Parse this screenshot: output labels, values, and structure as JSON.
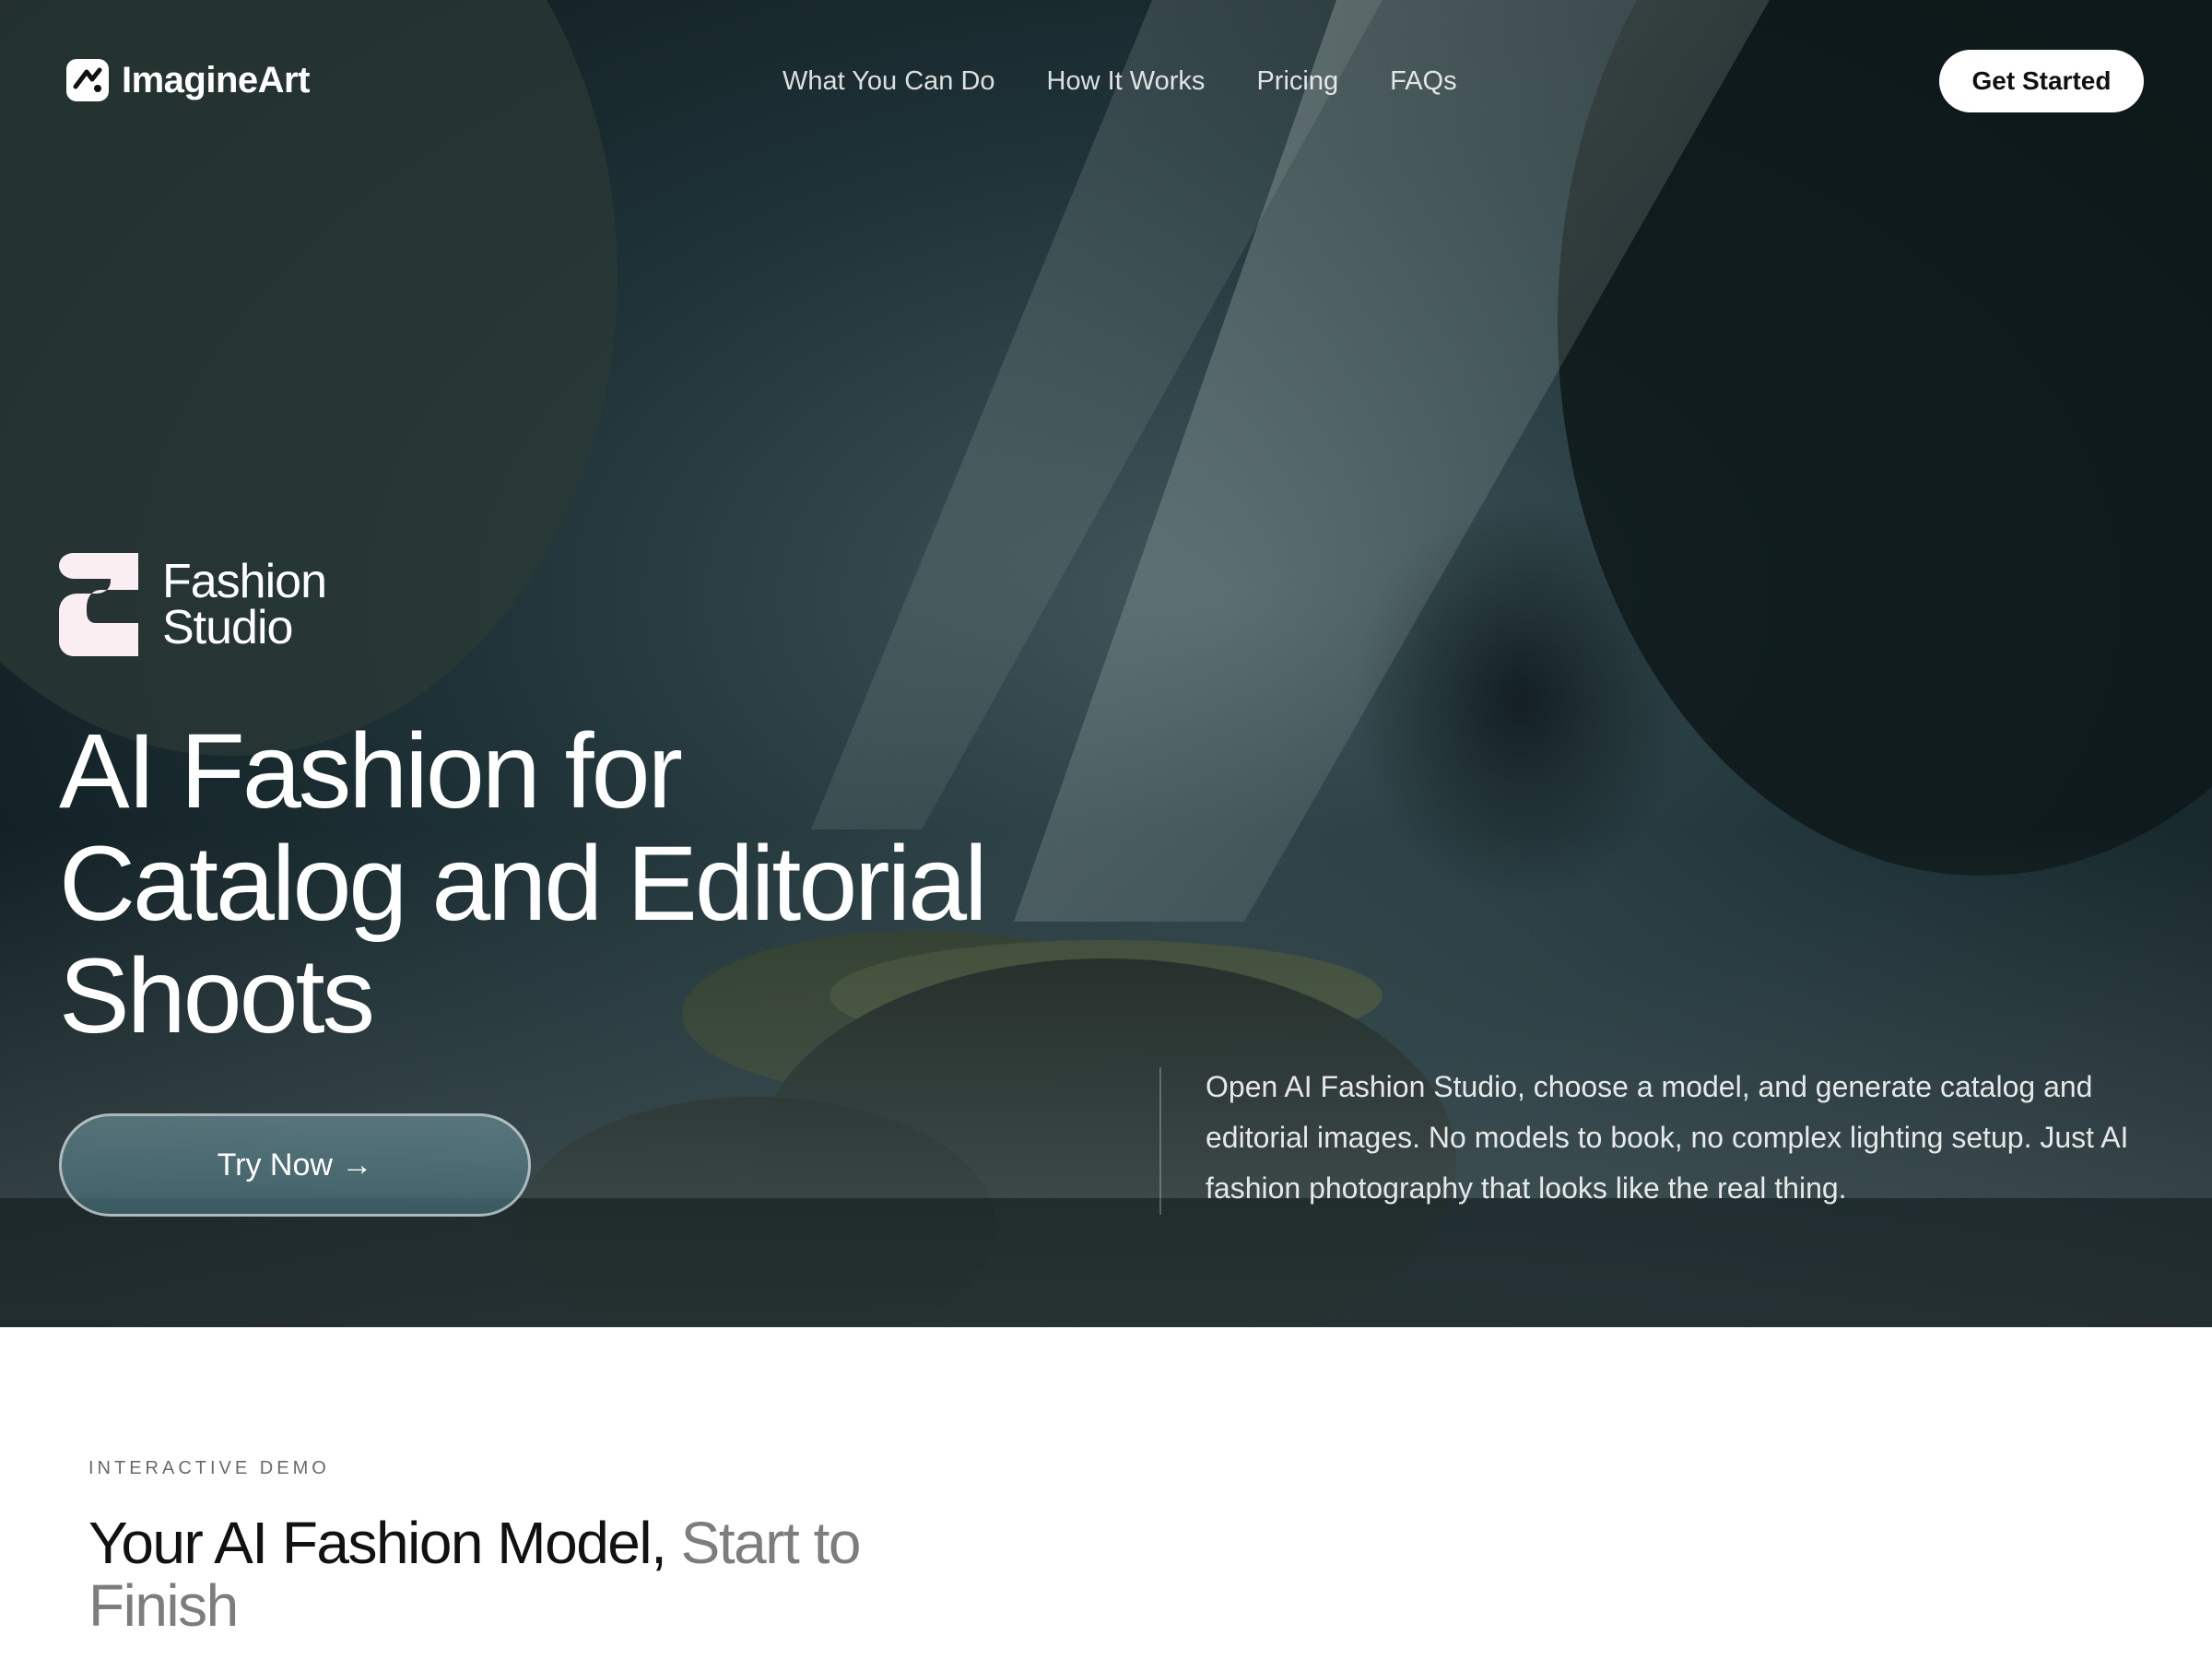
{
  "nav": {
    "brand": "ImagineArt",
    "links": [
      "What You Can Do",
      "How It Works",
      "Pricing",
      "FAQs"
    ],
    "cta": "Get Started"
  },
  "hero": {
    "badge_line1": "Fashion",
    "badge_line2": "Studio",
    "title_line1": "AI Fashion for",
    "title_line2": "Catalog and Editorial",
    "title_line3": "Shoots",
    "button": "Try Now →",
    "description": "Open AI Fashion Studio, choose a model, and generate catalog and editorial images. No models to book, no complex lighting setup. Just AI fashion photography that looks like the real thing."
  },
  "demo": {
    "eyebrow": "INTERACTIVE DEMO",
    "title_main": "Your AI Fashion Model,",
    "title_muted": "Start to Finish"
  },
  "colors": {
    "hero_bg": "#0e1a1e",
    "cta_bg": "#ffffff",
    "badge_icon": "#fbeef3",
    "muted_title": "#7d7d7d"
  },
  "icons": {
    "brand": "imagineart-logo-icon",
    "badge": "fashion-studio-logo-icon"
  }
}
